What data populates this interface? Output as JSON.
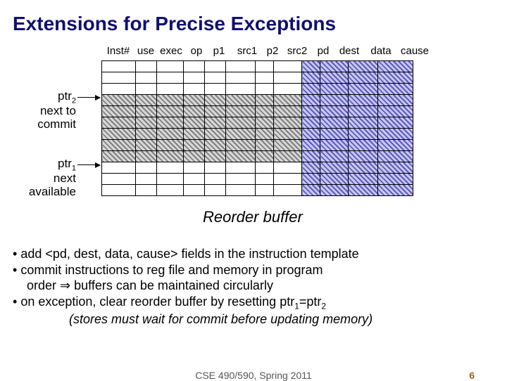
{
  "title": "Extensions for Precise Exceptions",
  "columns": [
    "Inst#",
    "use",
    "exec",
    "op",
    "p1",
    "src1",
    "p2",
    "src2",
    "pd",
    "dest",
    "data",
    "cause"
  ],
  "ptr2": {
    "label_line1": "ptr",
    "sub": "2",
    "label_line2": "next to",
    "label_line3": "commit"
  },
  "ptr1": {
    "label_line1": "ptr",
    "sub": "1",
    "label_line2": "next",
    "label_line3": "available"
  },
  "rob_caption": "Reorder buffer",
  "bullets": {
    "b1": "add <pd, dest, data, cause> fields in the instruction template",
    "b2a": "commit instructions to reg file and memory in program",
    "b2b_pre": "order ",
    "b2b_post": " buffers can be maintained circularly",
    "b3a": "on exception, clear reorder buffer by resetting ptr",
    "b3a_sub1": "1",
    "b3a_mid": "=ptr",
    "b3a_sub2": "2",
    "b3b": "(stores must wait for commit before updating memory)"
  },
  "footer": {
    "course": "CSE 490/590, Spring 2011",
    "page": "6"
  }
}
